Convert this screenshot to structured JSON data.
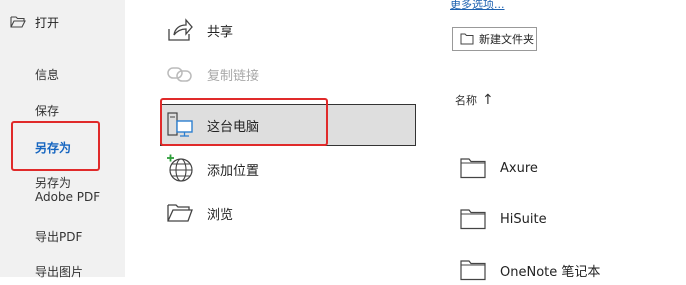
{
  "sidebar": {
    "open_label": "打开",
    "items": [
      {
        "label": "信息"
      },
      {
        "label": "保存"
      },
      {
        "label": "另存为"
      },
      {
        "label": "另存为\nAdobe PDF"
      },
      {
        "label": "导出PDF"
      },
      {
        "label": "导出图片"
      }
    ],
    "active_color": "#1565c0"
  },
  "locations": {
    "share": "共享",
    "copy_link": "复制链接",
    "this_pc": "这台电脑",
    "add_place": "添加位置",
    "browse": "浏览"
  },
  "right": {
    "more_options": "更多选项...",
    "new_folder": "新建文件夹",
    "column_name": "名称",
    "sort_arrow": "↑",
    "folders": [
      "Axure",
      "HiSuite",
      "OneNote 笔记本"
    ]
  },
  "highlight_color": "#e02a2a"
}
